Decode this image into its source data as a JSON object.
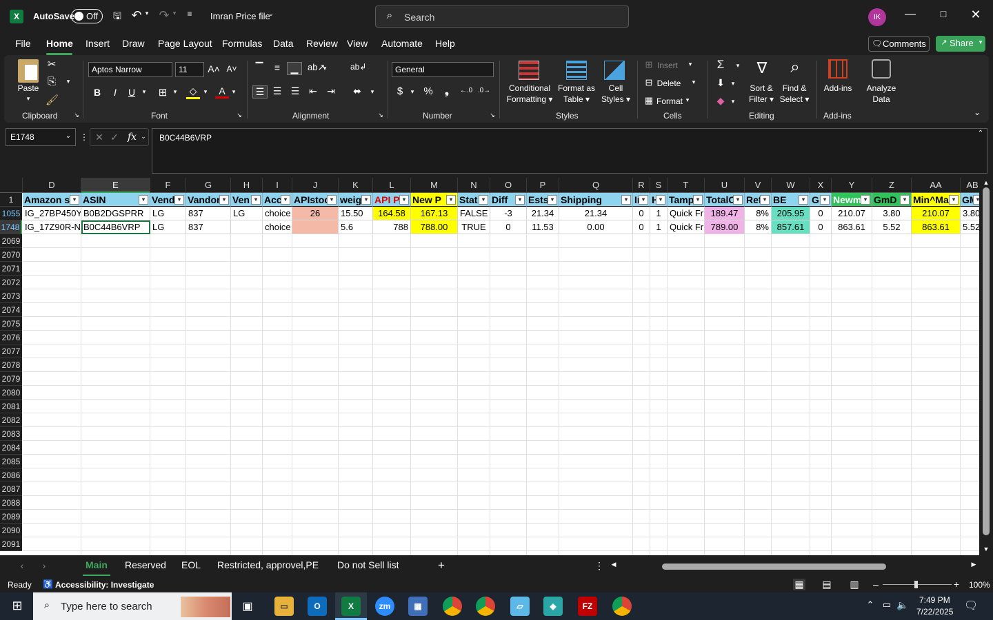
{
  "titlebar": {
    "autosave_label": "AutoSave",
    "autosave_state": "Off",
    "file_name": "Imran Price file",
    "search_placeholder": "Search",
    "avatar_initials": "IK"
  },
  "menu": [
    "File",
    "Home",
    "Insert",
    "Draw",
    "Page Layout",
    "Formulas",
    "Data",
    "Review",
    "View",
    "Automate",
    "Help"
  ],
  "active_menu": "Home",
  "comments_label": "Comments",
  "share_label": "Share",
  "ribbon": {
    "clipboard": {
      "label": "Clipboard",
      "paste": "Paste"
    },
    "font": {
      "label": "Font",
      "family": "Aptos Narrow",
      "size": "11"
    },
    "alignment": {
      "label": "Alignment"
    },
    "number": {
      "label": "Number",
      "format": "General"
    },
    "styles": {
      "label": "Styles",
      "conditional_1": "Conditional",
      "conditional_2": "Formatting",
      "format_table_1": "Format as",
      "format_table_2": "Table",
      "cell_styles_1": "Cell",
      "cell_styles_2": "Styles"
    },
    "cells": {
      "label": "Cells",
      "insert": "Insert",
      "delete": "Delete",
      "format": "Format"
    },
    "editing": {
      "label": "Editing",
      "sort_1": "Sort &",
      "sort_2": "Filter",
      "find_1": "Find &",
      "find_2": "Select"
    },
    "addins": {
      "label": "Add-ins",
      "addins_btn": "Add-ins",
      "analyze_1": "Analyze",
      "analyze_2": "Data"
    }
  },
  "formula_bar": {
    "name_box": "E1748",
    "fx": "fx",
    "content": "B0C44B6VRP"
  },
  "columns": [
    "D",
    "E",
    "F",
    "G",
    "H",
    "I",
    "J",
    "K",
    "L",
    "M",
    "N",
    "O",
    "P",
    "Q",
    "R",
    "S",
    "T",
    "U",
    "V",
    "W",
    "X",
    "Y",
    "Z",
    "AA",
    "AB"
  ],
  "header_row": {
    "row_number": "1",
    "cells": [
      "Amazon sl",
      "ASIN",
      "Vend",
      "Vandor",
      "Ven",
      "Acc",
      "APIstoc",
      "weig",
      "API P",
      "New P",
      "Stat",
      "Diff",
      "Ests",
      "Shipping",
      "In",
      "H",
      "Tamp",
      "TotalC",
      "Ref",
      "BE",
      "G",
      "Newm",
      "GmD",
      "Min^Ma",
      "GMD"
    ]
  },
  "rows": [
    {
      "row_number": "1055",
      "cells": [
        "IG_27BP450Y-",
        "B0B2DGSPRR",
        "LG",
        "837",
        "LG",
        "choice",
        "26",
        "15.50",
        "164.58",
        "167.13",
        "FALSE",
        "-3",
        "21.34",
        "21.34",
        "0",
        "1",
        "Quick Fr",
        "189.47",
        "8%",
        "205.95",
        "0",
        "210.07",
        "3.80",
        "210.07",
        "3.80"
      ]
    },
    {
      "row_number": "1748",
      "cells": [
        "IG_17Z90R-N.",
        "B0C44B6VRP",
        "LG",
        "837",
        "",
        "choice",
        "",
        "5.6",
        "788",
        "788.00",
        "TRUE",
        "0",
        "11.53",
        "0.00",
        "0",
        "1",
        "Quick Fr",
        "789.00",
        "8%",
        "857.61",
        "0",
        "863.61",
        "5.52",
        "863.61",
        "5.52"
      ]
    }
  ],
  "empty_rows": [
    "2069",
    "2070",
    "2071",
    "2072",
    "2073",
    "2074",
    "2075",
    "2076",
    "2077",
    "2078",
    "2079",
    "2080",
    "2081",
    "2082",
    "2083",
    "2084",
    "2085",
    "2086",
    "2087",
    "2088",
    "2089",
    "2090",
    "2091"
  ],
  "sheets": [
    "Main",
    "Reserved",
    "EOL",
    "Restricted, approvel,PE",
    "Do not Sell list"
  ],
  "active_sheet": "Main",
  "status": {
    "ready": "Ready",
    "accessibility": "Accessibility: Investigate",
    "zoom": "100%"
  },
  "taskbar": {
    "search_placeholder": "Type here to search",
    "time": "7:49 PM",
    "date": "7/22/2025"
  },
  "colors": {
    "header_blue": "#8ed4ee",
    "yellow": "#ffff00",
    "pink": "#f4b9a7",
    "lavender": "#f0b3e8",
    "teal": "#66e0c0",
    "green_accent": "#3ea95d",
    "red_text": "#e00000"
  }
}
